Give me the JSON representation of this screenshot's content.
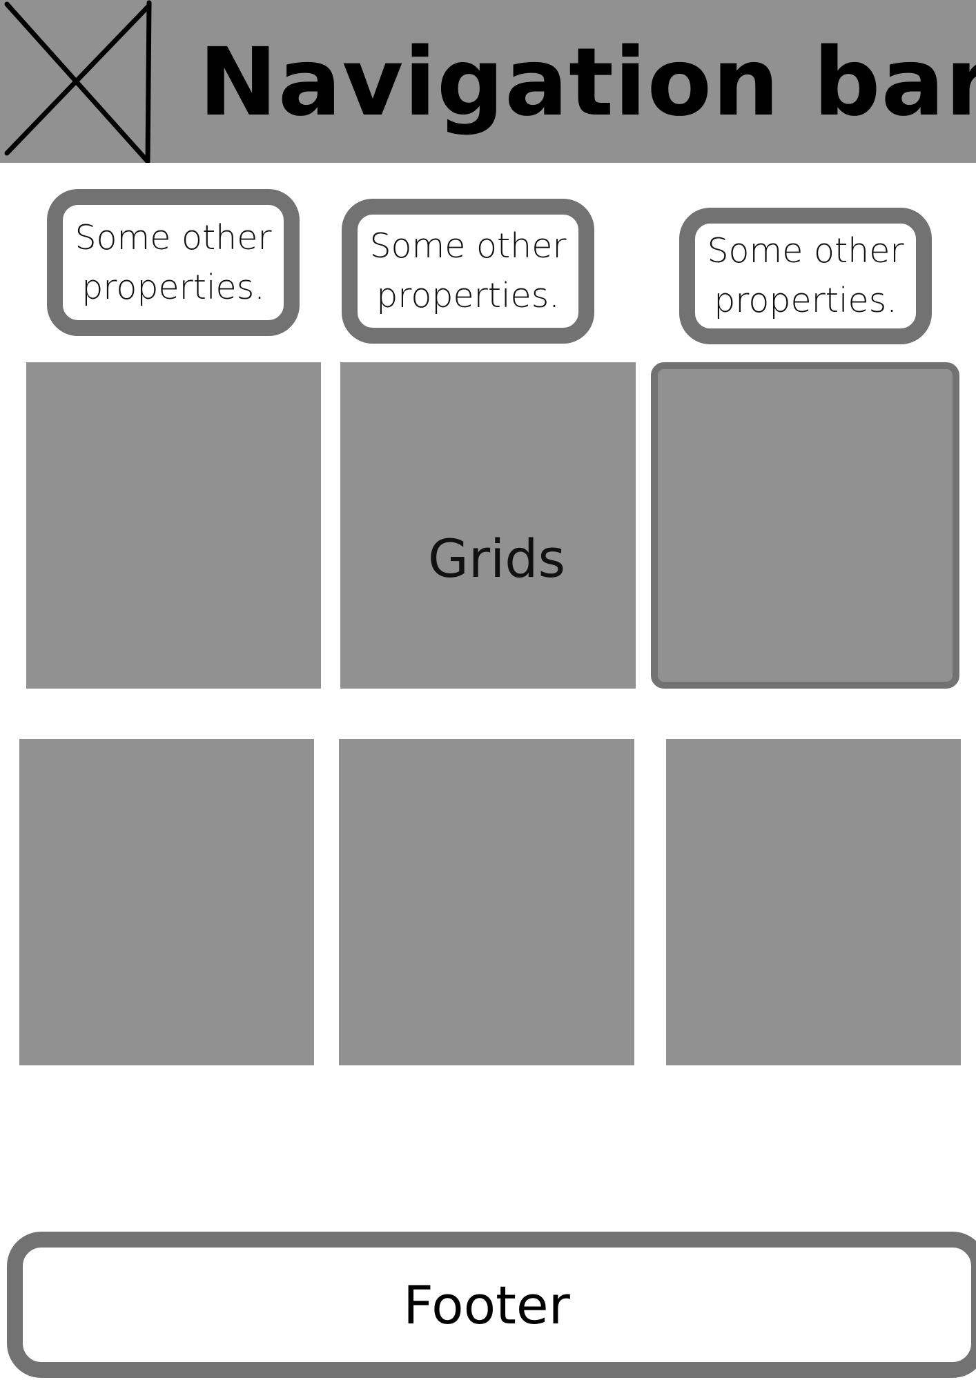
{
  "nav": {
    "title": "Navigation bar",
    "logo_icon": "image-placeholder-icon"
  },
  "properties": [
    {
      "text": "Some other properties."
    },
    {
      "text": "Some other properties."
    },
    {
      "text": "Some other properties."
    }
  ],
  "grid": {
    "label": "Grids"
  },
  "footer": {
    "label": "Footer"
  },
  "colors": {
    "block": "#919191",
    "border": "#727272",
    "background": "#ffffff"
  }
}
